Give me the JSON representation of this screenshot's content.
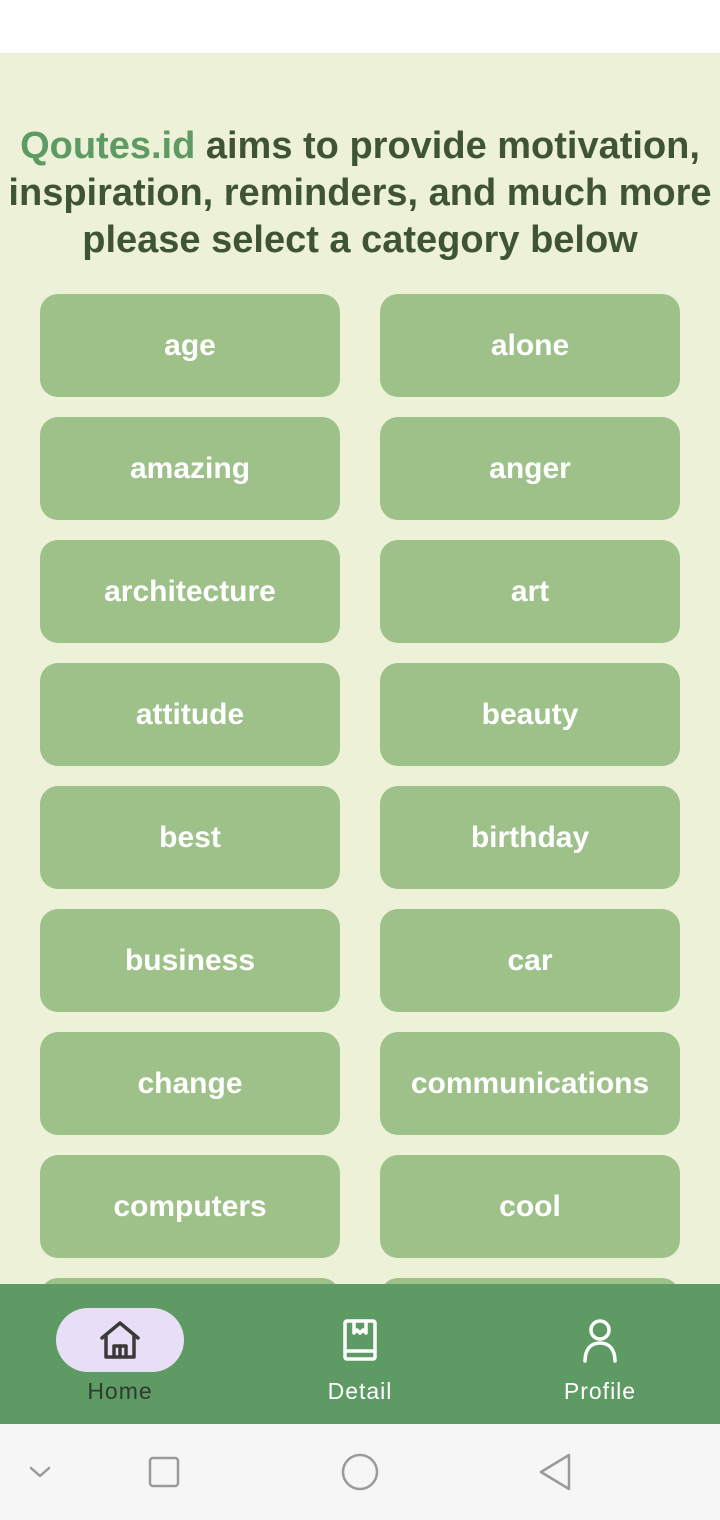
{
  "header": {
    "brand": "Qoutes.id",
    "line1_rest": " aims to provide motivation,",
    "line2": "inspiration, reminders, and much more",
    "line3": "please select a category below"
  },
  "categories": [
    "age",
    "alone",
    "amazing",
    "anger",
    "architecture",
    "art",
    "attitude",
    "beauty",
    "best",
    "birthday",
    "business",
    "car",
    "change",
    "communications",
    "computers",
    "cool"
  ],
  "bottom_nav": {
    "items": [
      {
        "label": "Home",
        "icon": "home-icon",
        "active": true
      },
      {
        "label": "Detail",
        "icon": "book-icon",
        "active": false
      },
      {
        "label": "Profile",
        "icon": "person-icon",
        "active": false
      }
    ]
  },
  "colors": {
    "background": "#edf1d7",
    "brand": "#5e9a63",
    "headline": "#3f5337",
    "button": "#9ec18a",
    "nav_bar": "#5e9a63",
    "nav_active": "#e8def6"
  }
}
